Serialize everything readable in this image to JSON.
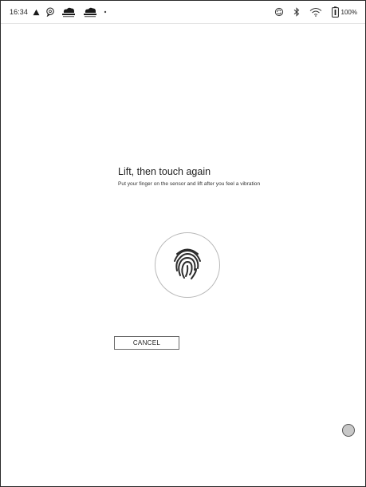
{
  "statusbar": {
    "time": "16:34",
    "left_icons": [
      "alert-triangle-icon",
      "chat-bubble-icon",
      "cloud-sync-icon",
      "cloud-sync-icon",
      "dot-icon"
    ],
    "right_icons": [
      "sync-icon",
      "bluetooth-icon",
      "wifi-icon",
      "battery-icon"
    ],
    "battery": "100%"
  },
  "dialog": {
    "title": "Lift, then touch again",
    "subtitle": "Put your finger on the sensor and lift after you feel a vibration",
    "fingerprint_icon": "fingerprint-icon",
    "cancel_label": "CANCEL"
  },
  "floating_button": {
    "icon": "circle-dot-icon"
  }
}
